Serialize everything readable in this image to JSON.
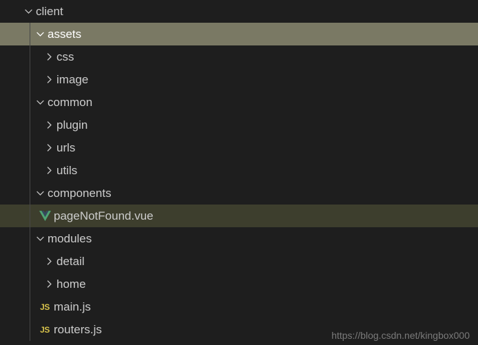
{
  "tree": {
    "client": "client",
    "assets": "assets",
    "css": "css",
    "image": "image",
    "common": "common",
    "plugin": "plugin",
    "urls": "urls",
    "utils": "utils",
    "components": "components",
    "pageNotFound": "pageNotFound.vue",
    "modules": "modules",
    "detail": "detail",
    "home": "home",
    "mainjs": "main.js",
    "routersjs": "routers.js"
  },
  "icons": {
    "js": "JS"
  },
  "watermark": "https://blog.csdn.net/kingbox000"
}
